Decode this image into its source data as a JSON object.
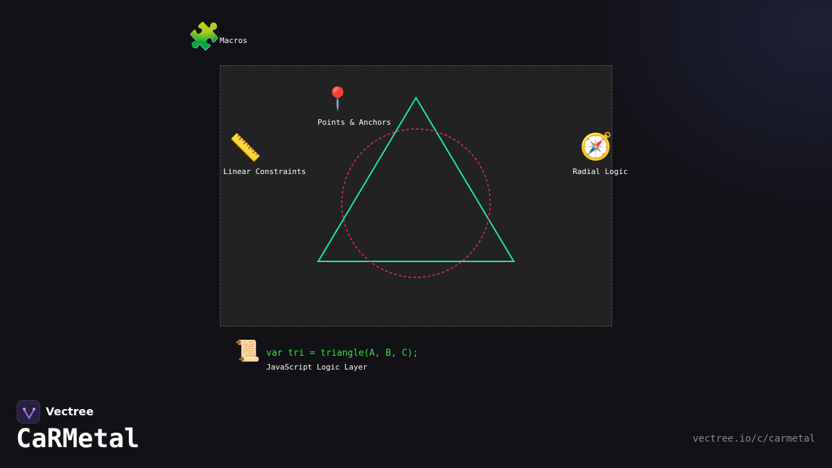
{
  "nodes": {
    "macros": {
      "icon": "puzzle-icon",
      "glyph": "🧩",
      "label": "Macros"
    },
    "points": {
      "icon": "pin-icon",
      "glyph": "📍",
      "label": "Points & Anchors"
    },
    "linear": {
      "icon": "ruler-icon",
      "glyph": "📏",
      "label": "Linear Constraints"
    },
    "radial": {
      "icon": "compass-icon",
      "glyph": "🧭",
      "label": "Radial Logic"
    }
  },
  "code": {
    "icon": "scroll-icon",
    "glyph": "📜",
    "line": "var tri = triangle(A, B, C);",
    "caption": "JavaScript Logic Layer"
  },
  "colors": {
    "triangle": "#1de9b6",
    "circle": "#e0305a",
    "code": "#33e04a",
    "background": "#111116",
    "canvas": "#222222"
  },
  "brand": {
    "logo_icon": "vectree-logo-icon",
    "name": "Vectree",
    "product": "CaRMetal",
    "url": "vectree.io/c/carmetal"
  }
}
